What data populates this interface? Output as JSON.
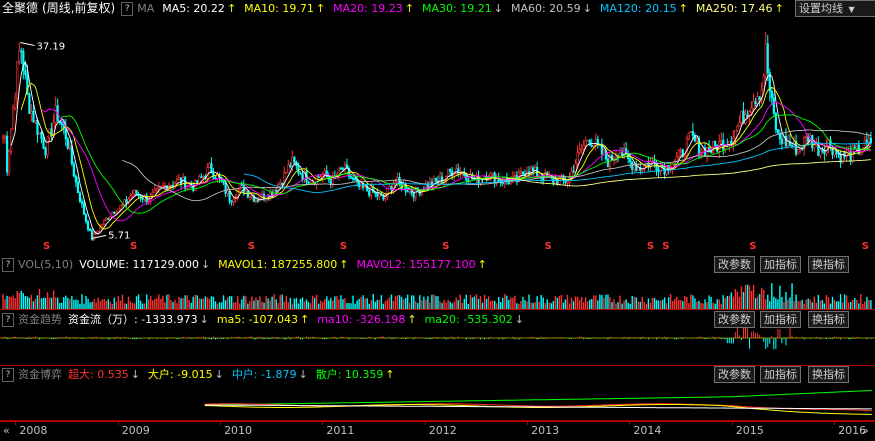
{
  "stock_name": "全聚德",
  "period_label": "(周线,前复权)",
  "ma_panel": {
    "label": "MA",
    "items": [
      {
        "label": "MA5: 20.22",
        "arrow": "↑",
        "color": "#ffffff"
      },
      {
        "label": "MA10: 19.71",
        "arrow": "↑",
        "color": "#ffff00"
      },
      {
        "label": "MA20: 19.23",
        "arrow": "↑",
        "color": "#ff00ff"
      },
      {
        "label": "MA30: 19.21",
        "arrow": "↓",
        "color": "#00ff00"
      },
      {
        "label": "MA60: 20.59",
        "arrow": "↓",
        "color": "#c0c0c0"
      },
      {
        "label": "MA120: 20.15",
        "arrow": "↑",
        "color": "#00c8ff"
      },
      {
        "label": "MA250: 17.46",
        "arrow": "↑",
        "color": "#ffff80"
      }
    ],
    "button": "设置均线",
    "arrow_colors": {
      "up": "#ffff00",
      "down": "#c0c0c0"
    }
  },
  "vol_panel": {
    "label": "VOL(5,10)",
    "items": [
      {
        "label": "VOLUME: 117129.000",
        "arrow": "↓",
        "color": "#ffffff"
      },
      {
        "label": "MAVOL1: 187255.800",
        "arrow": "↑",
        "color": "#ffff00"
      },
      {
        "label": "MAVOL2: 155177.100",
        "arrow": "↑",
        "color": "#ff00ff"
      }
    ],
    "buttons": [
      "改参数",
      "加指标",
      "换指标"
    ]
  },
  "flow_panel": {
    "label": "资金趋势",
    "items": [
      {
        "label": "资金流（万）: -1333.973",
        "arrow": "↓",
        "color": "#ffffff"
      },
      {
        "label": "ma5: -107.043",
        "arrow": "↑",
        "color": "#ffff00"
      },
      {
        "label": "ma10: -326.198",
        "arrow": "↑",
        "color": "#ff00ff"
      },
      {
        "label": "ma20: -535.302",
        "arrow": "↓",
        "color": "#00ff00"
      }
    ],
    "buttons": [
      "改参数",
      "加指标",
      "换指标"
    ]
  },
  "game_panel": {
    "label": "资金博弈",
    "items": [
      {
        "label": "超大: 0.535",
        "arrow": "↓",
        "color": "#ff3030"
      },
      {
        "label": "大户: -9.015",
        "arrow": "↓",
        "color": "#ffff00"
      },
      {
        "label": "中户: -1.879",
        "arrow": "↓",
        "color": "#00c8ff"
      },
      {
        "label": "散户: 10.359",
        "arrow": "↑",
        "color": "#00ff00"
      }
    ],
    "buttons": [
      "改参数",
      "加指标",
      "换指标"
    ]
  },
  "nav_left": "«",
  "nav_right": "»",
  "chart_data": {
    "type": "candlestick",
    "x_labels": [
      "2008",
      "2009",
      "2010",
      "2011",
      "2012",
      "2013",
      "2014",
      "2015",
      "2016"
    ],
    "annotations": {
      "high": "37.19",
      "low": "5.71"
    },
    "dividend_marker": "S",
    "dividend_years": [
      2008.3,
      2009.15,
      2010.3,
      2011.2,
      2012.2,
      2013.2,
      2014.2,
      2014.35,
      2015.2,
      2016.3
    ],
    "price_path": [
      [
        2007.9,
        14
      ],
      [
        2008.0,
        30
      ],
      [
        2008.05,
        37.19
      ],
      [
        2008.12,
        28
      ],
      [
        2008.2,
        24
      ],
      [
        2008.3,
        20
      ],
      [
        2008.4,
        26
      ],
      [
        2008.5,
        22
      ],
      [
        2008.6,
        14
      ],
      [
        2008.7,
        8
      ],
      [
        2008.75,
        5.71
      ],
      [
        2008.85,
        8
      ],
      [
        2008.95,
        10
      ],
      [
        2009.05,
        11
      ],
      [
        2009.15,
        13
      ],
      [
        2009.3,
        12
      ],
      [
        2009.45,
        14
      ],
      [
        2009.6,
        15
      ],
      [
        2009.75,
        14
      ],
      [
        2009.9,
        17
      ],
      [
        2010.0,
        15
      ],
      [
        2010.1,
        12
      ],
      [
        2010.2,
        14
      ],
      [
        2010.35,
        12
      ],
      [
        2010.5,
        13
      ],
      [
        2010.6,
        15
      ],
      [
        2010.7,
        18
      ],
      [
        2010.8,
        16
      ],
      [
        2010.9,
        15
      ],
      [
        2011.0,
        16
      ],
      [
        2011.1,
        15
      ],
      [
        2011.2,
        17
      ],
      [
        2011.35,
        14
      ],
      [
        2011.5,
        13
      ],
      [
        2011.6,
        12
      ],
      [
        2011.7,
        15
      ],
      [
        2011.8,
        14
      ],
      [
        2011.9,
        13
      ],
      [
        2012.0,
        14
      ],
      [
        2012.15,
        15
      ],
      [
        2012.3,
        17
      ],
      [
        2012.4,
        16
      ],
      [
        2012.5,
        15
      ],
      [
        2012.6,
        16
      ],
      [
        2012.75,
        15
      ],
      [
        2012.9,
        15
      ],
      [
        2013.0,
        17
      ],
      [
        2013.1,
        16
      ],
      [
        2013.25,
        15
      ],
      [
        2013.4,
        15
      ],
      [
        2013.5,
        19
      ],
      [
        2013.6,
        22
      ],
      [
        2013.7,
        20
      ],
      [
        2013.8,
        18
      ],
      [
        2013.9,
        20
      ],
      [
        2014.0,
        18
      ],
      [
        2014.1,
        17
      ],
      [
        2014.2,
        18
      ],
      [
        2014.35,
        17
      ],
      [
        2014.5,
        19
      ],
      [
        2014.6,
        22
      ],
      [
        2014.7,
        20
      ],
      [
        2014.8,
        20
      ],
      [
        2014.9,
        21
      ],
      [
        2015.0,
        22
      ],
      [
        2015.1,
        25
      ],
      [
        2015.2,
        28
      ],
      [
        2015.3,
        30
      ],
      [
        2015.33,
        36
      ],
      [
        2015.38,
        28
      ],
      [
        2015.45,
        22
      ],
      [
        2015.55,
        21
      ],
      [
        2015.65,
        20
      ],
      [
        2015.75,
        22
      ],
      [
        2015.85,
        20
      ],
      [
        2015.95,
        21
      ],
      [
        2016.05,
        19
      ],
      [
        2016.15,
        19
      ],
      [
        2016.25,
        20
      ],
      [
        2016.35,
        21
      ],
      [
        2016.38,
        22
      ]
    ],
    "ylim": [
      4,
      40
    ],
    "xlim": [
      2007.85,
      2016.4
    ]
  }
}
